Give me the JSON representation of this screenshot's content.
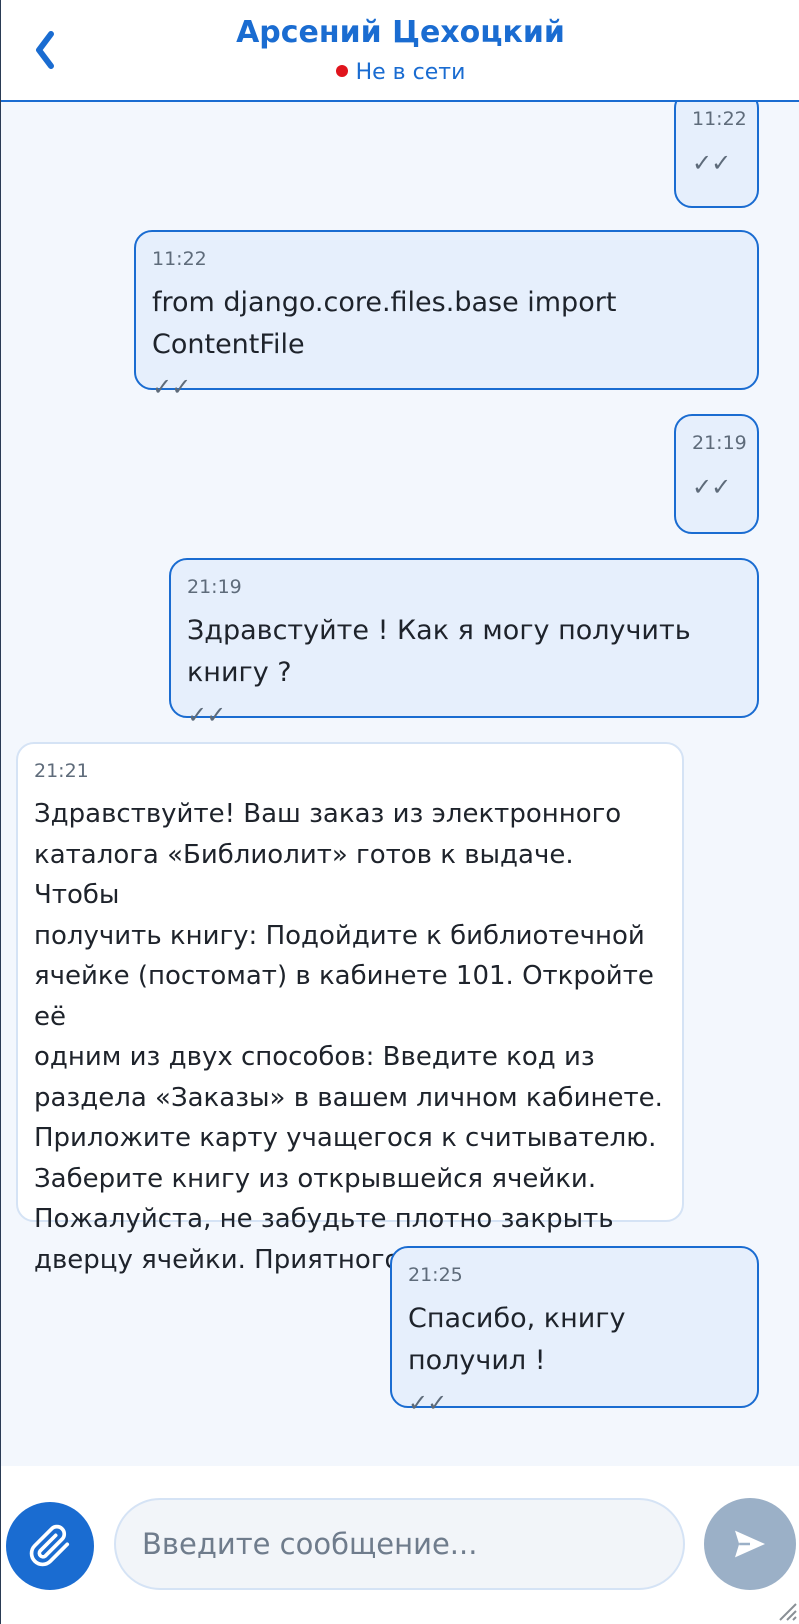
{
  "header": {
    "back_icon": "chevron-left-icon",
    "contact_name": "Арсений Цехоцкий",
    "status": "Не в сети",
    "status_color": "#e0141c"
  },
  "messages": [
    {
      "direction": "out",
      "time": "11:22",
      "text": "",
      "status": "✓✓"
    },
    {
      "direction": "out",
      "time": "11:22",
      "text": "from django.core.files.base import ContentFile",
      "status": "✓✓"
    },
    {
      "direction": "out",
      "time": "21:19",
      "text": "",
      "status": "✓✓"
    },
    {
      "direction": "out",
      "time": "21:19",
      "text": "Здравстуйте ! Как я могу получить книгу ?",
      "status": "✓✓"
    },
    {
      "direction": "in",
      "time": "21:21",
      "text": "Здравствуйте! Ваш заказ из электронного\nкаталога «Библиолит» готов к выдаче. Чтобы\nполучить книгу: Подойдите к библиотечной\nячейке (постомат) в кабинете 101. Откройте её\nодним из двух способов: Введите код из\nраздела «Заказы» в вашем личном кабинете.\nПриложите карту учащегося к считывателю.\nЗаберите книгу из открывшейся ячейки.\nПожалуйста, не забудьте плотно закрыть\nдверцу ячейки. Приятного чтения!",
      "status": ""
    },
    {
      "direction": "out",
      "time": "21:25",
      "text": "Спасибо, книгу получил !",
      "status": "✓✓"
    }
  ],
  "composer": {
    "attach_icon": "paperclip-icon",
    "placeholder": "Введите сообщение...",
    "value": "",
    "send_icon": "send-icon"
  },
  "colors": {
    "accent": "#1a6cd1",
    "outgoing_bubble": "#e6effc",
    "incoming_bubble": "#ffffff",
    "chat_background": "#f3f7fd",
    "send_button_disabled": "#9bb0c7"
  }
}
